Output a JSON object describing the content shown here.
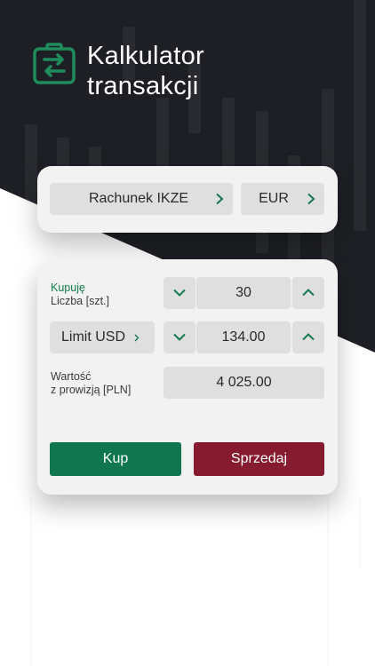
{
  "colors": {
    "dark_bg": "#1d1f24",
    "accent_green": "#1f8c5c",
    "buy": "#0f7650",
    "sell": "#861b30",
    "card": "#f3f2f3",
    "field": "#dfdfe0"
  },
  "header": {
    "icon": "briefcase-exchange-icon",
    "title_line1": "Kalkulator",
    "title_line2": "transakcji"
  },
  "account": {
    "name": "Rachunek IKZE",
    "currency": "EUR",
    "icon": "chevron-right-icon"
  },
  "order": {
    "side_label": "Kupuję",
    "quantity_label": "Liczba [szt.]",
    "quantity": "30",
    "type_label": "Limit USD",
    "type_icon": "chevron-right-icon",
    "price": "134.00",
    "value_label_line1": "Wartość",
    "value_label_line2": "z prowizją [PLN]",
    "value": "4 025.00",
    "decrease_icon": "chevron-down-icon",
    "increase_icon": "chevron-up-icon"
  },
  "actions": {
    "buy_label": "Kup",
    "sell_label": "Sprzedaj"
  }
}
